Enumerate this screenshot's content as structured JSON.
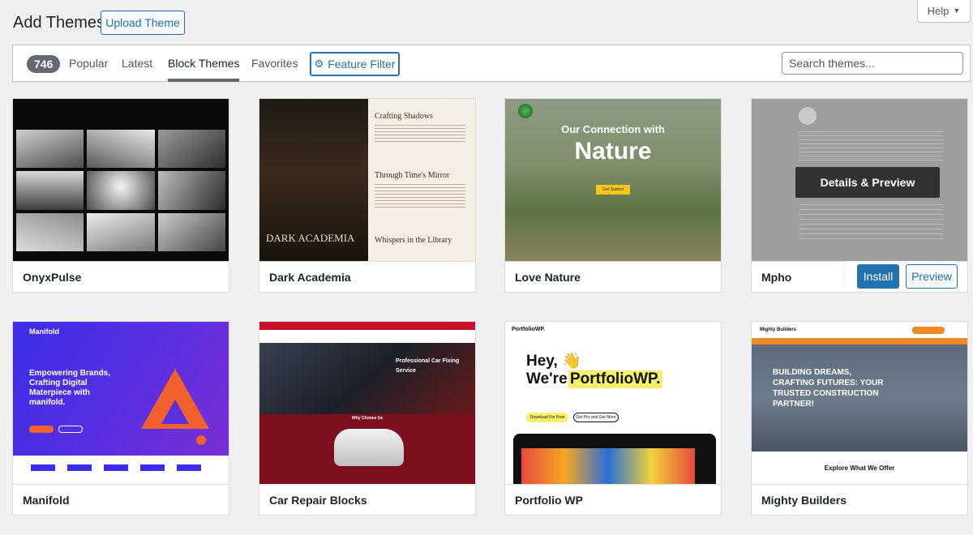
{
  "header": {
    "title": "Add Themes",
    "upload_label": "Upload Theme",
    "help_label": "Help"
  },
  "filter_bar": {
    "count": "746",
    "tabs": [
      {
        "label": "Popular"
      },
      {
        "label": "Latest"
      },
      {
        "label": "Block Themes"
      },
      {
        "label": "Favorites"
      }
    ],
    "active_tab": "Block Themes",
    "feature_filter_label": "Feature Filter",
    "search_placeholder": "Search themes..."
  },
  "themes": [
    {
      "name": "OnyxPulse"
    },
    {
      "name": "Dark Academia"
    },
    {
      "name": "Love Nature"
    },
    {
      "name": "Mpho",
      "hovered": true,
      "details_label": "Details & Preview",
      "install_label": "Install",
      "preview_label": "Preview"
    },
    {
      "name": "Manifold"
    },
    {
      "name": "Car Repair Blocks"
    },
    {
      "name": "Portfolio WP"
    },
    {
      "name": "Mighty Builders"
    }
  ],
  "screenshots": {
    "dark_academia": {
      "wordmark": "DARK ACADEMIA",
      "heading_1": "Crafting Shadows",
      "heading_2": "Through Time's Mirror",
      "heading_3": "Whispers in the Library"
    },
    "love_nature": {
      "headline_1": "Our Connection with",
      "headline_2": "Nature",
      "cta": "Get Started"
    },
    "manifold": {
      "logo": "Manifold",
      "headline": "Empowering Brands, Crafting Digital Materpiece with manifold."
    },
    "car_repair": {
      "headline_1": "Professional Car Fixing",
      "headline_2": "Service",
      "section": "Why Choose Us"
    },
    "portfolio_wp": {
      "logo": "PortfolioWP.",
      "hello": "Hey, 👋",
      "were": "We're",
      "brand": "PortfolioWP.",
      "btn_1": "Download For Free",
      "btn_2": "Get Pro and Get More"
    },
    "mighty": {
      "logo": "Mighty Builders",
      "headline": "BUILDING DREAMS, CRAFTING FUTURES: YOUR TRUSTED CONSTRUCTION PARTNER!",
      "section": "Explore What We Offer"
    }
  },
  "colors": {
    "accent": "#2271b1",
    "count_badge": "#646970"
  }
}
